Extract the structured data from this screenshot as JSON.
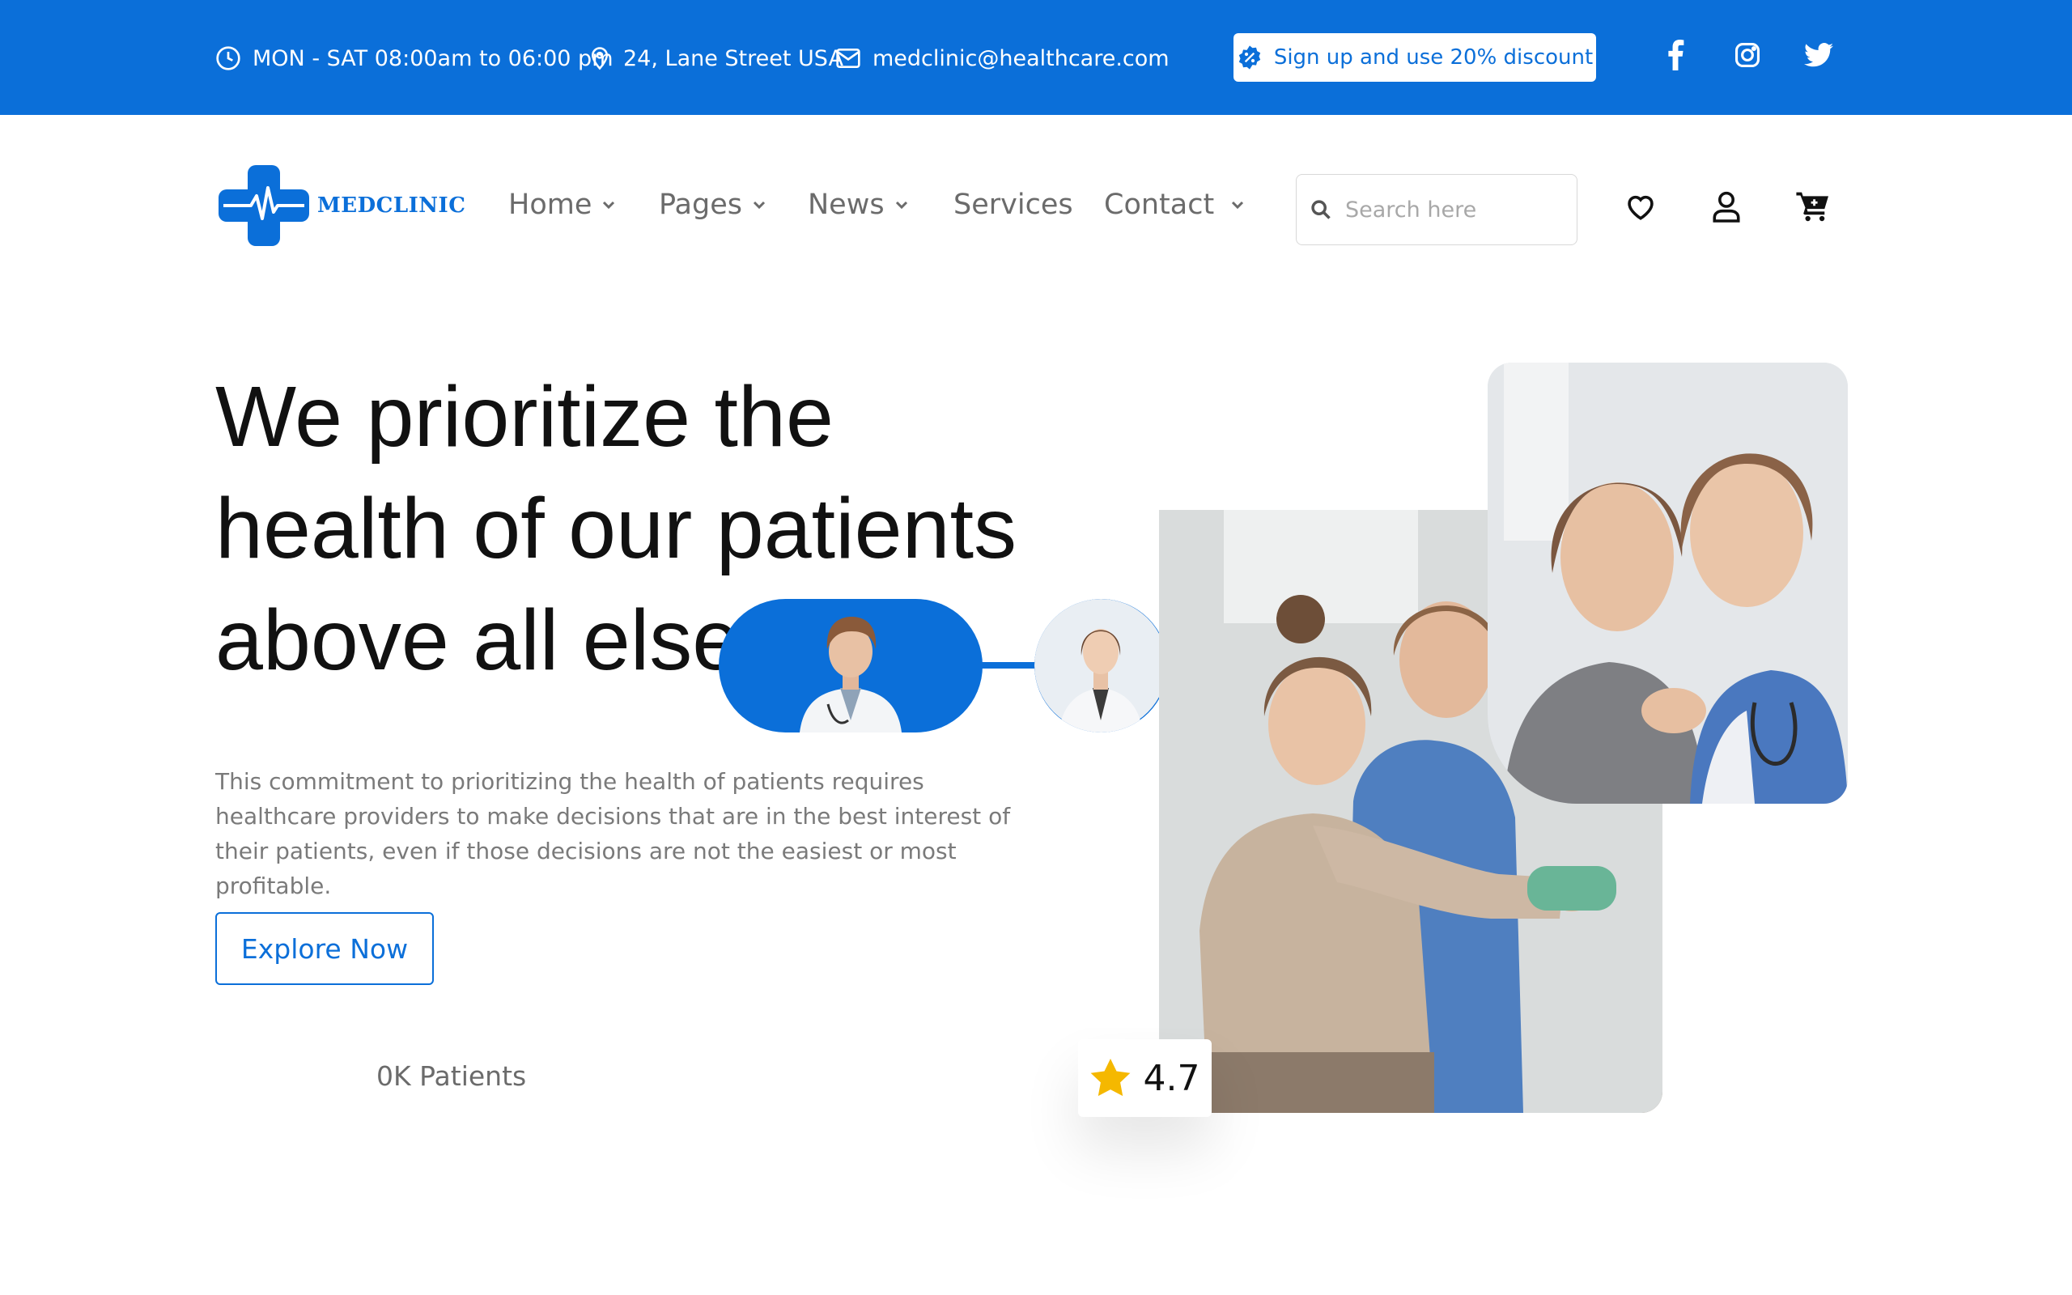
{
  "topbar": {
    "hours": "MON - SAT 08:00am to 06:00 pm",
    "address": "24, Lane Street USA",
    "email": "medclinic@healthcare.com",
    "promo": "Sign up and use 20% discount",
    "social": [
      "facebook-icon",
      "instagram-icon",
      "twitter-icon"
    ]
  },
  "brand": {
    "name": "MEDCLINIC"
  },
  "nav": {
    "items": [
      {
        "label": "Home",
        "dropdown": true
      },
      {
        "label": "Pages",
        "dropdown": true
      },
      {
        "label": "News",
        "dropdown": true
      },
      {
        "label": "Services",
        "dropdown": false
      },
      {
        "label": "Contact",
        "dropdown": true
      }
    ],
    "search_placeholder": "Search here",
    "icons": [
      "heart-icon",
      "user-icon",
      "cart-icon"
    ]
  },
  "hero": {
    "headline_line1": "We prioritize the",
    "headline_line2": "health of our patients",
    "headline_line3": "above all else",
    "description": "This commitment to prioritizing the health of patients requires healthcare providers to make decisions that are in the best interest of their patients, even if those decisions are not the easiest or most profitable.",
    "cta": "Explore Now",
    "patients": "0K Patients",
    "rating": "4.7"
  },
  "colors": {
    "primary": "#0b6fd9",
    "text": "#111111",
    "muted": "#7a7a7a",
    "star": "#f5b800"
  }
}
